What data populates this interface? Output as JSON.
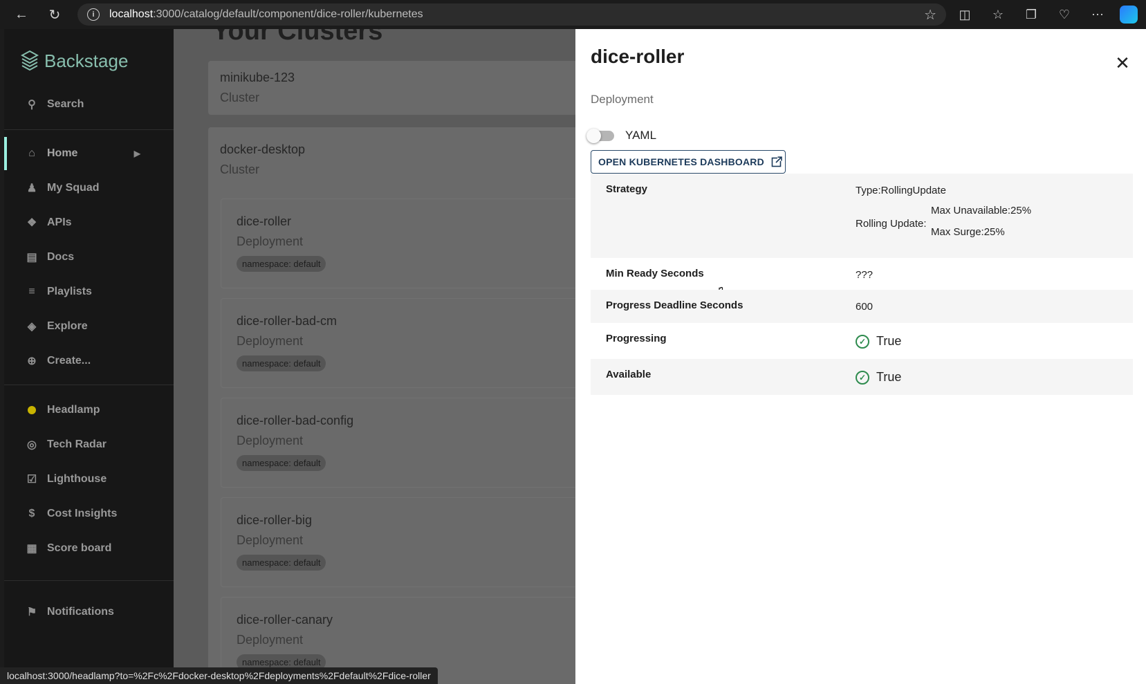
{
  "browser": {
    "url_host": "localhost",
    "url_path": ":3000/catalog/default/component/dice-roller/kubernetes",
    "status_link": "localhost:3000/headlamp?to=%2Fc%2Fdocker-desktop%2Fdeployments%2Fdefault%2Fdice-roller"
  },
  "sidebar": {
    "brand": "Backstage",
    "search_label": "Search",
    "items": [
      {
        "label": "Home",
        "icon": "home-icon"
      },
      {
        "label": "My Squad",
        "icon": "people-icon"
      },
      {
        "label": "APIs",
        "icon": "puzzle-icon"
      },
      {
        "label": "Docs",
        "icon": "document-icon"
      },
      {
        "label": "Playlists",
        "icon": "playlist-icon"
      },
      {
        "label": "Explore",
        "icon": "layers-icon"
      },
      {
        "label": "Create...",
        "icon": "add-circle-icon"
      }
    ],
    "plugins": [
      {
        "label": "Headlamp",
        "icon": "headlamp-icon"
      },
      {
        "label": "Tech Radar",
        "icon": "radar-icon"
      },
      {
        "label": "Lighthouse",
        "icon": "lighthouse-icon"
      },
      {
        "label": "Cost Insights",
        "icon": "dollar-icon"
      },
      {
        "label": "Score board",
        "icon": "scoreboard-icon"
      }
    ],
    "notifications_label": "Notifications"
  },
  "main": {
    "title": "Your Clusters",
    "clusters": [
      {
        "name": "minikube-123",
        "type": "Cluster"
      },
      {
        "name": "docker-desktop",
        "type": "Cluster"
      }
    ],
    "deployments": [
      {
        "name": "dice-roller",
        "type": "Deployment",
        "namespace": "namespace: default"
      },
      {
        "name": "dice-roller-bad-cm",
        "type": "Deployment",
        "namespace": "namespace: default"
      },
      {
        "name": "dice-roller-bad-config",
        "type": "Deployment",
        "namespace": "namespace: default"
      },
      {
        "name": "dice-roller-big",
        "type": "Deployment",
        "namespace": "namespace: default"
      },
      {
        "name": "dice-roller-canary",
        "type": "Deployment",
        "namespace": "namespace: default"
      }
    ]
  },
  "drawer": {
    "title": "dice-roller",
    "kind": "Deployment",
    "yaml_label": "YAML",
    "yaml_enabled": false,
    "dashboard_button": "OPEN KUBERNETES DASHBOARD",
    "strategy": {
      "label": "Strategy",
      "type": "Type:RollingUpdate",
      "rolling_label": "Rolling Update:",
      "max_unavailable": "Max Unavailable:25%",
      "max_surge": "Max Surge:25%"
    },
    "min_ready": {
      "label": "Min Ready Seconds",
      "value": "???"
    },
    "progress_deadline": {
      "label": "Progress Deadline Seconds",
      "value": "600"
    },
    "progressing": {
      "label": "Progressing",
      "value": "True"
    },
    "available": {
      "label": "Available",
      "value": "True"
    }
  }
}
